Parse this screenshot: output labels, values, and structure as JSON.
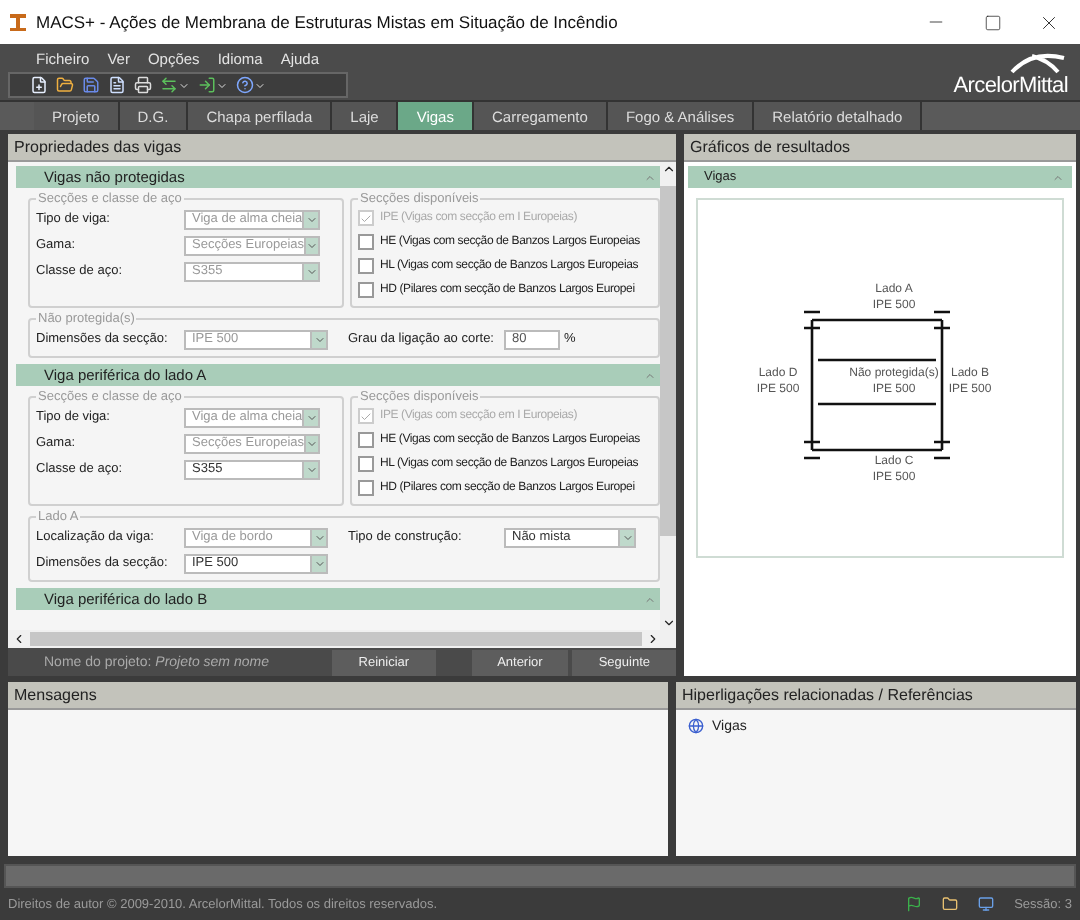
{
  "window": {
    "title": "MACS+ - Ações de Membrana de Estruturas Mistas em Situação de Incêndio"
  },
  "menu": [
    "Ficheiro",
    "Ver",
    "Opções",
    "Idioma",
    "Ajuda"
  ],
  "logo": {
    "text": "ArcelorMittal"
  },
  "tabs": [
    {
      "label": "Projeto",
      "selected": false
    },
    {
      "label": "D.G.",
      "selected": false
    },
    {
      "label": "Chapa perfilada",
      "selected": false
    },
    {
      "label": "Laje",
      "selected": false
    },
    {
      "label": "Vigas",
      "selected": true
    },
    {
      "label": "Carregamento",
      "selected": false
    },
    {
      "label": "Fogo & Análises",
      "selected": false
    },
    {
      "label": "Relatório detalhado",
      "selected": false
    }
  ],
  "left_panel": {
    "title": "Propriedades das vigas",
    "sections": [
      {
        "title": "Vigas não protegidas",
        "steel": {
          "title": "Secções e classe de aço",
          "fields": [
            {
              "label": "Tipo de viga:",
              "value": "Viga de alma cheia",
              "disabled": true
            },
            {
              "label": "Gama:",
              "value": "Secções Europeias",
              "disabled": true
            },
            {
              "label": "Classe de aço:",
              "value": "S355",
              "disabled": true
            }
          ]
        },
        "available": {
          "title": "Secções disponíveis",
          "options": [
            {
              "label": "IPE (Vigas com secção em I Europeias)",
              "checked": true,
              "disabled": true
            },
            {
              "label": "HE (Vigas com secção de Banzos Largos Europeias",
              "checked": false,
              "disabled": false
            },
            {
              "label": "HL (Vigas com secção de Banzos Largos Europeias",
              "checked": false,
              "disabled": false
            },
            {
              "label": "HD (Pilares com secção de Banzos Largos Europei",
              "checked": false,
              "disabled": false
            }
          ]
        },
        "extra": {
          "title": "Não protegida(s)",
          "rows": [
            [
              {
                "kind": "select",
                "label": "Dimensões da secção:",
                "value": "IPE 500",
                "disabled": true
              },
              {
                "kind": "input",
                "label": "Grau da ligação ao corte:",
                "value": "80",
                "unit": "%"
              }
            ]
          ]
        }
      },
      {
        "title": "Viga periférica do lado A",
        "steel": {
          "title": "Secções e classe de aço",
          "fields": [
            {
              "label": "Tipo de viga:",
              "value": "Viga de alma cheia",
              "disabled": true
            },
            {
              "label": "Gama:",
              "value": "Secções Europeias",
              "disabled": true
            },
            {
              "label": "Classe de aço:",
              "value": "S355",
              "disabled": false
            }
          ]
        },
        "available": {
          "title": "Secções disponíveis",
          "options": [
            {
              "label": "IPE (Vigas com secção em I Europeias)",
              "checked": true,
              "disabled": true
            },
            {
              "label": "HE (Vigas com secção de Banzos Largos Europeias",
              "checked": false,
              "disabled": false
            },
            {
              "label": "HL (Vigas com secção de Banzos Largos Europeias",
              "checked": false,
              "disabled": false
            },
            {
              "label": "HD (Pilares com secção de Banzos Largos Europei",
              "checked": false,
              "disabled": false
            }
          ]
        },
        "extra": {
          "title": "Lado A",
          "rows": [
            [
              {
                "kind": "select",
                "label": "Localização da viga:",
                "value": "Viga de bordo",
                "disabled": true
              },
              {
                "kind": "select",
                "label": "Tipo de construção:",
                "value": "Não mista",
                "disabled": false
              }
            ],
            [
              {
                "kind": "select",
                "label": "Dimensões da secção:",
                "value": "IPE 500",
                "disabled": false
              }
            ]
          ]
        }
      },
      {
        "title": "Viga periférica do lado B"
      }
    ]
  },
  "nav": {
    "project": "Nome do projeto: *Projeto sem nome*",
    "buttons": [
      "Reiniciar",
      "Anterior",
      "Seguinte"
    ]
  },
  "right_panel": {
    "title": "Gráficos de resultados",
    "section": "Vigas",
    "labels": [
      {
        "kind": "top",
        "name": "Lado A",
        "section": "IPE 500"
      },
      {
        "kind": "left",
        "name": "Lado D",
        "section": "IPE 500"
      },
      {
        "kind": "center",
        "name": "Não protegida(s)",
        "section": "IPE 500"
      },
      {
        "kind": "right",
        "name": "Lado B",
        "section": "IPE 500"
      },
      {
        "kind": "bottom",
        "name": "Lado C",
        "section": "IPE 500"
      }
    ]
  },
  "messages": {
    "title": "Mensagens"
  },
  "links": {
    "title": "Hiperligações relacionadas / Referências",
    "items": [
      "Vigas"
    ]
  },
  "status_bar": {
    "copyright": "Direitos de autor © 2009-2010. ArcelorMittal. Todos os direitos reservados.",
    "session": "Sessão: 3"
  }
}
